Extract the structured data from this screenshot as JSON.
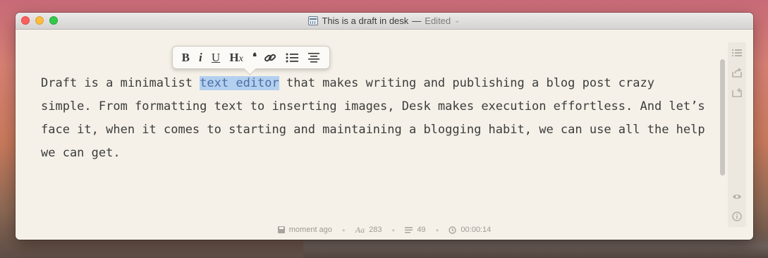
{
  "window": {
    "title": "This is a draft in desk",
    "title_separator": "—",
    "status": "Edited"
  },
  "toolbar": {
    "bold": "B",
    "italic": "i",
    "underline": "U",
    "heading": "H",
    "heading_sub": "x",
    "quote": "❛❛"
  },
  "editor": {
    "text_before": "Draft is a minimalist ",
    "selected_text": "text editor",
    "text_after": " that makes writing and publishing a blog post crazy simple. From formatting text to inserting images, Desk makes execution effortless. And let’s face it, when it comes to starting and maintaining a blogging habit, we can use all the help we can get."
  },
  "status_bar": {
    "saved": "moment ago",
    "font_icon": "Aa",
    "word_count": "283",
    "line_count": "49",
    "timer": "00:00:14"
  },
  "colors": {
    "selection": "#b4d0ef",
    "background": "#f5f1e8"
  },
  "icons": [
    "list-icon",
    "share-icon",
    "publish-icon",
    "preview-icon",
    "info-icon",
    "link-icon",
    "bullet-list-icon",
    "align-icon"
  ]
}
